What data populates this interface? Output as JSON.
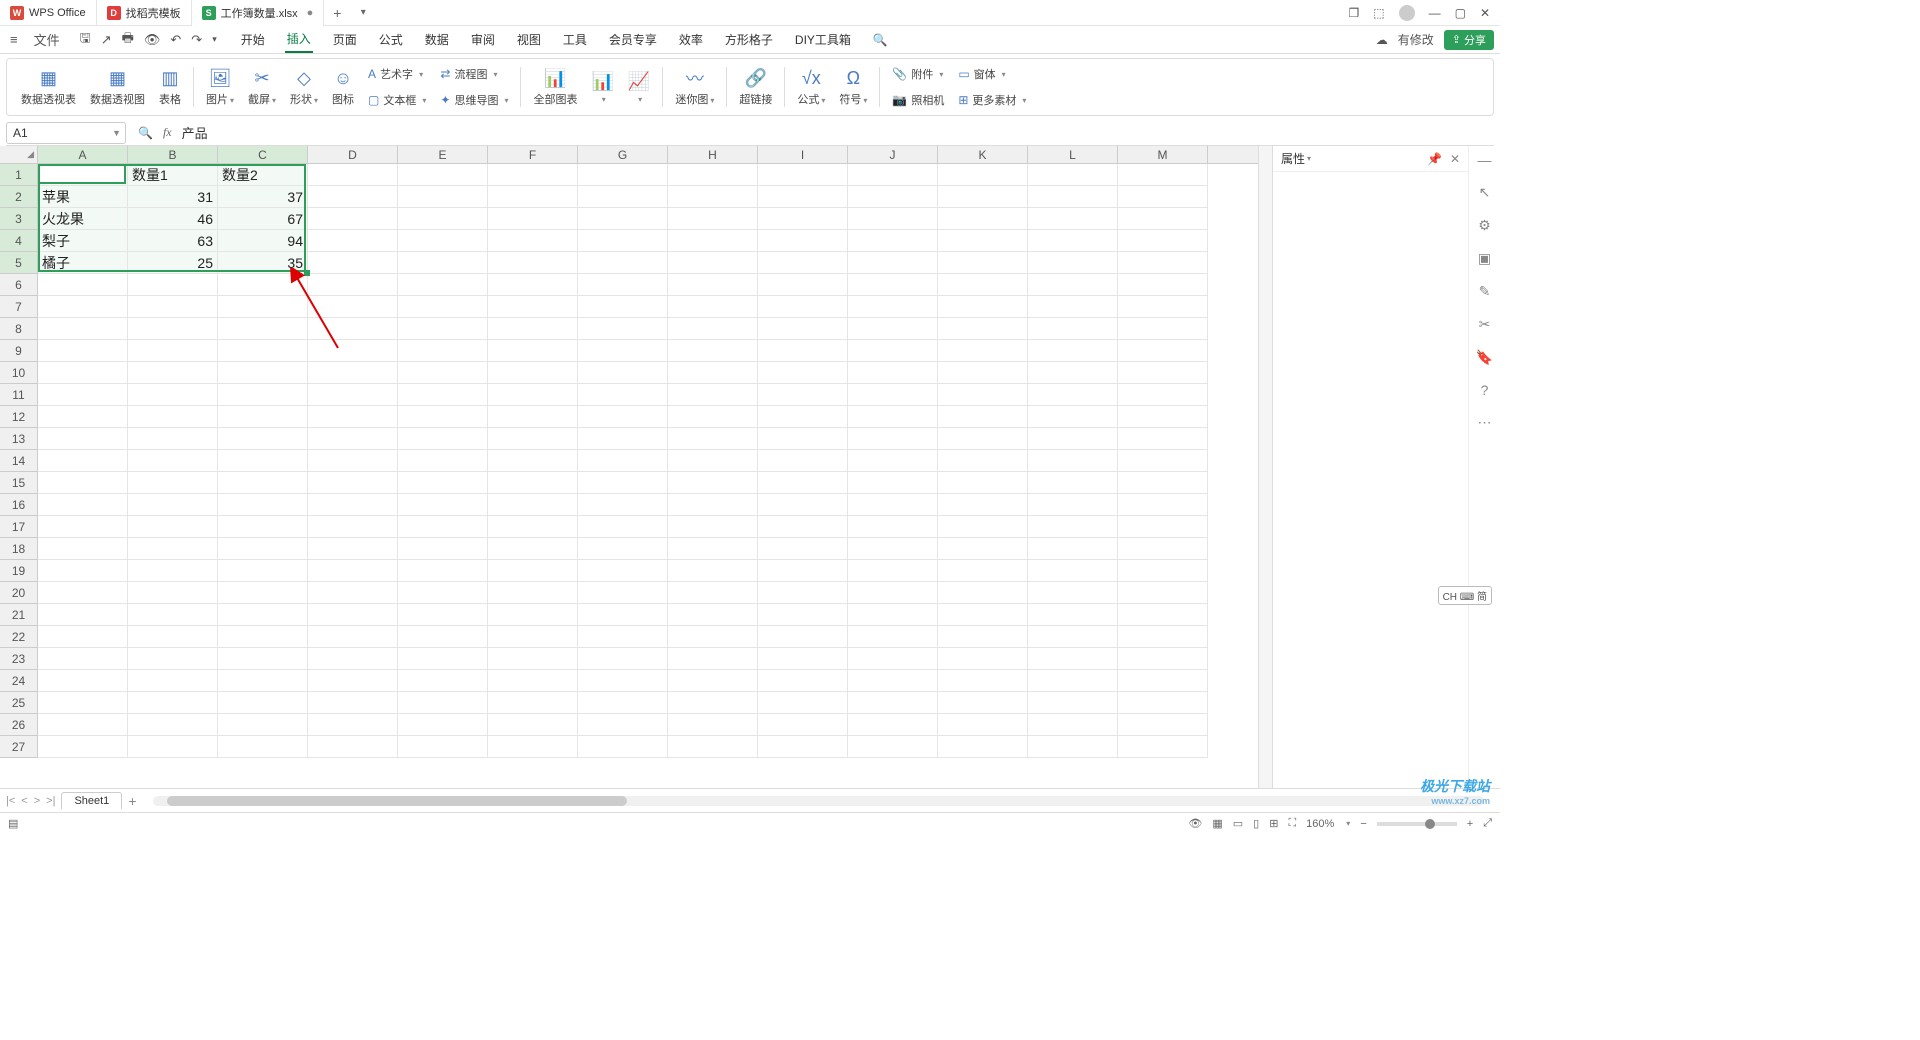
{
  "titlebar": {
    "tabs": [
      {
        "icon": "W",
        "iconClass": "w-red",
        "label": "WPS Office"
      },
      {
        "icon": "D",
        "iconClass": "d-red",
        "label": "找稻壳模板"
      },
      {
        "icon": "S",
        "iconClass": "s-grn",
        "label": "工作簿数量.xlsx",
        "modified": "●"
      }
    ]
  },
  "menu": {
    "file": "文件",
    "tabs": [
      "开始",
      "插入",
      "页面",
      "公式",
      "数据",
      "审阅",
      "视图",
      "工具",
      "会员专享",
      "效率",
      "方形格子",
      "DIY工具箱"
    ],
    "activeTab": "插入",
    "hasChanges": "有修改",
    "share": "分享"
  },
  "ribbon": {
    "g1": {
      "a": "数据透视表",
      "b": "数据透视图",
      "c": "表格"
    },
    "g2": {
      "a": "图片",
      "b": "截屏",
      "c": "形状",
      "d": "图标"
    },
    "g3": {
      "a": "艺术字",
      "b": "流程图",
      "c": "文本框",
      "d": "思维导图"
    },
    "g4": {
      "a": "全部图表"
    },
    "g5": {
      "a": "迷你图"
    },
    "g6": {
      "a": "超链接"
    },
    "g7": {
      "a": "公式",
      "b": "符号"
    },
    "g8": {
      "a": "附件",
      "b": "窗体",
      "c": "照相机",
      "d": "更多素材"
    }
  },
  "namebox": {
    "ref": "A1",
    "formula": "产品"
  },
  "sheet": {
    "columns": [
      "A",
      "B",
      "C",
      "D",
      "E",
      "F",
      "G",
      "H",
      "I",
      "J",
      "K",
      "L",
      "M"
    ],
    "rows": 27,
    "selCols": 3,
    "selRows": 5,
    "data": [
      [
        "产品",
        "数量1",
        "数量2"
      ],
      [
        "苹果",
        "31",
        "37"
      ],
      [
        "火龙果",
        "46",
        "67"
      ],
      [
        "梨子",
        "63",
        "94"
      ],
      [
        "橘子",
        "25",
        "35"
      ]
    ]
  },
  "rightPane": {
    "title": "属性"
  },
  "tabs": {
    "sheet": "Sheet1"
  },
  "status": {
    "zoom": "160%"
  },
  "ime": "CH ⌨ 简",
  "watermark": {
    "main": "极光下载站",
    "sub": "www.xz7.com"
  }
}
